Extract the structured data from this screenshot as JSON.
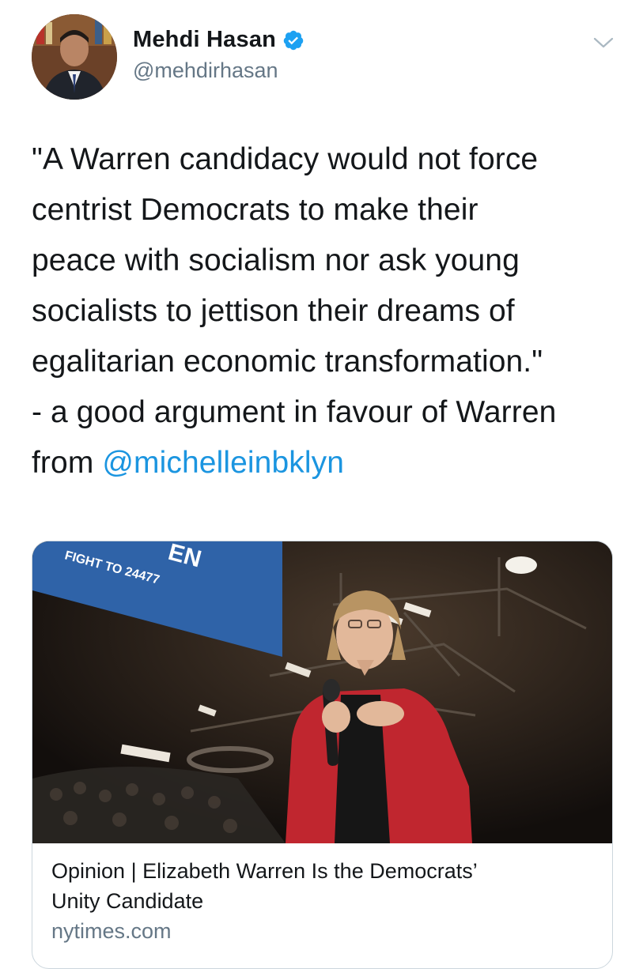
{
  "user": {
    "display_name": "Mehdi Hasan",
    "handle": "@mehdirhasan",
    "verified": true,
    "avatar_icon": "profile-photo"
  },
  "menu_icon": "chevron-down-icon",
  "tweet": {
    "lines": [
      "\"A Warren candidacy would not force",
      "centrist Democrats to make their",
      "peace with socialism nor ask young",
      "socialists to jettison their dreams of",
      "egalitarian economic transformation.\"",
      "- a good argument in favour of Warren"
    ],
    "last_line_prefix": "from ",
    "mention": "@michelleinbklyn"
  },
  "card": {
    "banner_text": "FIGHT TO 24477",
    "banner_partial": "EN",
    "title_lines": [
      "Opinion | Elizabeth Warren Is the Democrats’",
      "Unity Candidate"
    ],
    "domain": "nytimes.com"
  },
  "colors": {
    "link": "#1b95e0",
    "verified": "#1da1f2",
    "secondary_text": "#657786",
    "border": "#ccd6dd",
    "banner": "#2f63a8"
  }
}
